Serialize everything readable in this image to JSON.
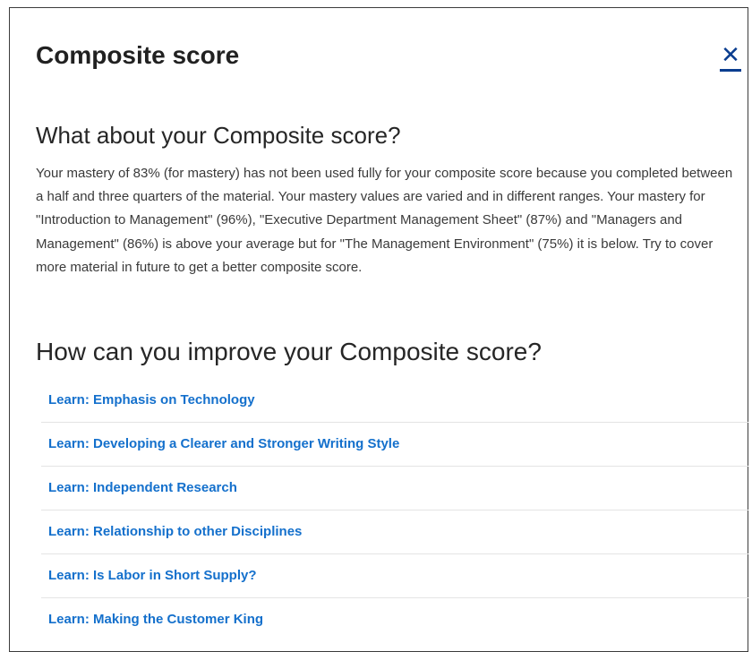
{
  "dialog": {
    "title": "Composite score",
    "close_label": "✕"
  },
  "what_section": {
    "heading": "What about your Composite score?",
    "body": "Your mastery of 83% (for mastery) has not been used fully for your composite score because you completed between a half and three quarters of the material. Your mastery values are varied and in different ranges. Your mastery for \"Introduction to Management\" (96%), \"Executive Department Management Sheet\" (87%) and \"Managers and Management\" (86%) is above your average but for \"The Management Environment\" (75%) it is below. Try to cover more material in future to get a better composite score."
  },
  "improve_section": {
    "heading": "How can you improve your Composite score?",
    "links": [
      {
        "label": "Learn: Emphasis on Technology"
      },
      {
        "label": "Learn: Developing a Clearer and Stronger Writing Style"
      },
      {
        "label": "Learn: Independent Research"
      },
      {
        "label": "Learn: Relationship to other Disciplines"
      },
      {
        "label": "Learn: Is Labor in Short Supply?"
      },
      {
        "label": "Learn: Making the Customer King"
      }
    ]
  },
  "colors": {
    "link": "#1470cc",
    "close_icon": "#0a3d8f",
    "heading_text": "#212121",
    "body_text": "#3a3a3a",
    "divider": "#e4e4e4"
  }
}
